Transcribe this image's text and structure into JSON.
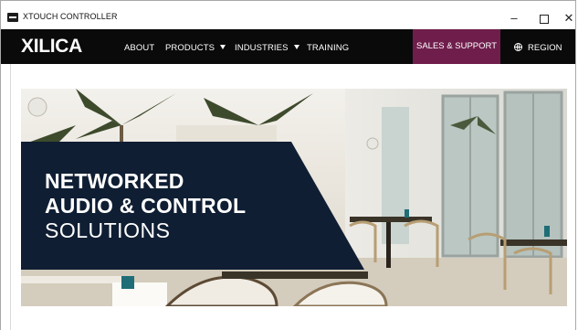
{
  "window": {
    "title": "XTOUCH CONTROLLER",
    "controls": {
      "minimize": "–",
      "close": "✕"
    }
  },
  "nav": {
    "logo": "XILICA",
    "items": [
      {
        "label": "ABOUT",
        "has_dropdown": false
      },
      {
        "label": "PRODUCTS",
        "has_dropdown": true
      },
      {
        "label": "INDUSTRIES",
        "has_dropdown": true
      },
      {
        "label": "TRAINING",
        "has_dropdown": false
      }
    ],
    "sales_label": "SALES & SUPPORT",
    "region_label": "REGION",
    "colors": {
      "bar": "#0a0a0a",
      "sales_bg": "#6f1e4c",
      "text": "#ffffff"
    }
  },
  "hero": {
    "line1": "NETWORKED",
    "line2": "AUDIO & CONTROL",
    "line3": "SOLUTIONS",
    "panel_color": "#0f1e33"
  }
}
